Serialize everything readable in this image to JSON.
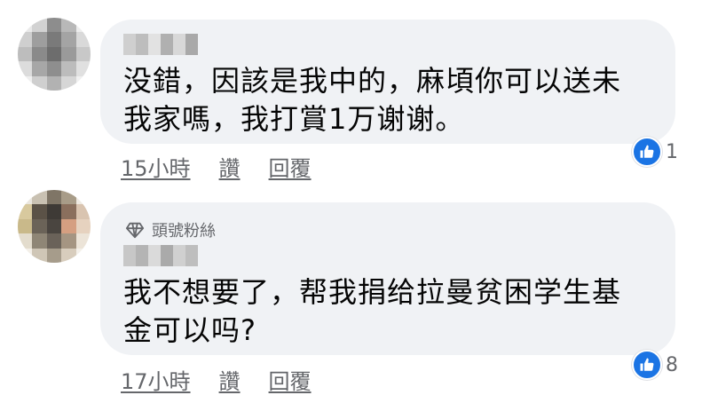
{
  "comments": [
    {
      "badge": "",
      "text": "没錯，因該是我中的，麻頃你可以送未\n我家嗎，我打賞1万谢谢。",
      "time": "15小時",
      "like_label": "讚",
      "reply_label": "回覆",
      "reaction_count": "1"
    },
    {
      "badge": "頭號粉絲",
      "text": "我不想要了，帮我捐给拉曼贫困学生基\n金可以吗?",
      "time": "17小時",
      "like_label": "讚",
      "reply_label": "回覆",
      "reaction_count": "8"
    }
  ],
  "colors": {
    "bubble": "#f0f2f5",
    "like_blue": "#1b74e4",
    "meta_gray": "#65676b"
  }
}
